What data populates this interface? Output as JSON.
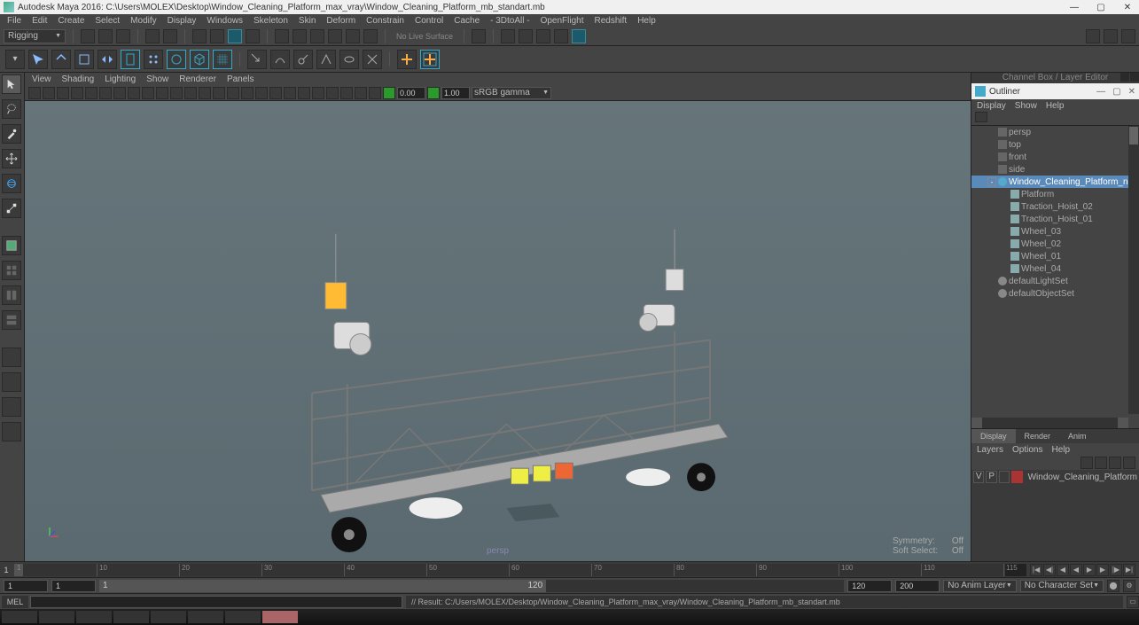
{
  "titlebar": {
    "text": "Autodesk Maya 2016: C:\\Users\\MOLEX\\Desktop\\Window_Cleaning_Platform_max_vray\\Window_Cleaning_Platform_mb_standart.mb"
  },
  "menubar": [
    "File",
    "Edit",
    "Create",
    "Select",
    "Modify",
    "Display",
    "Windows",
    "Skeleton",
    "Skin",
    "Deform",
    "Constrain",
    "Control",
    "Cache",
    "- 3DtoAll -",
    "OpenFlight",
    "Redshift",
    "Help"
  ],
  "workspace": {
    "label": "Rigging",
    "noLiveSurface": "No Live Surface"
  },
  "viewport": {
    "menubar": [
      "View",
      "Shading",
      "Lighting",
      "Show",
      "Renderer",
      "Panels"
    ],
    "gamma_a": "0.00",
    "gamma_b": "1.00",
    "colorspace": "sRGB gamma",
    "camera_label": "persp",
    "symmetry": {
      "label": "Symmetry:",
      "value": "Off"
    },
    "softselect": {
      "label": "Soft Select:",
      "value": "Off"
    }
  },
  "channelbox_header": "Channel Box / Layer Editor",
  "outliner": {
    "title": "Outliner",
    "menubar": [
      "Display",
      "Show",
      "Help"
    ],
    "items": [
      {
        "type": "cam",
        "name": "persp",
        "indent": 1
      },
      {
        "type": "cam",
        "name": "top",
        "indent": 1
      },
      {
        "type": "cam",
        "name": "front",
        "indent": 1
      },
      {
        "type": "cam",
        "name": "side",
        "indent": 1
      },
      {
        "type": "node",
        "name": "Window_Cleaning_Platform_nd",
        "indent": 1,
        "expand": "-",
        "sel": true
      },
      {
        "type": "mesh",
        "name": "Platform",
        "indent": 2
      },
      {
        "type": "mesh",
        "name": "Traction_Hoist_02",
        "indent": 2
      },
      {
        "type": "mesh",
        "name": "Traction_Hoist_01",
        "indent": 2
      },
      {
        "type": "mesh",
        "name": "Wheel_03",
        "indent": 2
      },
      {
        "type": "mesh",
        "name": "Wheel_02",
        "indent": 2
      },
      {
        "type": "mesh",
        "name": "Wheel_01",
        "indent": 2
      },
      {
        "type": "mesh",
        "name": "Wheel_04",
        "indent": 2
      },
      {
        "type": "set",
        "name": "defaultLightSet",
        "indent": 1
      },
      {
        "type": "set",
        "name": "defaultObjectSet",
        "indent": 1
      }
    ]
  },
  "layers": {
    "tabs": [
      "Display",
      "Render",
      "Anim"
    ],
    "menubar": [
      "Layers",
      "Options",
      "Help"
    ],
    "row": {
      "v": "V",
      "p": "P",
      "name": "Window_Cleaning_Platform"
    }
  },
  "timeslider": {
    "current": "1",
    "marks": [
      "1",
      "10",
      "20",
      "30",
      "40",
      "50",
      "60",
      "70",
      "80",
      "90",
      "100",
      "110",
      "115"
    ],
    "end": " "
  },
  "range": {
    "start_out": "1",
    "start_in": "1",
    "in_label": "1",
    "out_label": "120",
    "end_in": "120",
    "end_out": "200",
    "anim_layer": "No Anim Layer",
    "char_set": "No Character Set"
  },
  "cmd": {
    "label": "MEL",
    "result": "// Result: C:/Users/MOLEX/Desktop/Window_Cleaning_Platform_max_vray/Window_Cleaning_Platform_mb_standart.mb"
  }
}
